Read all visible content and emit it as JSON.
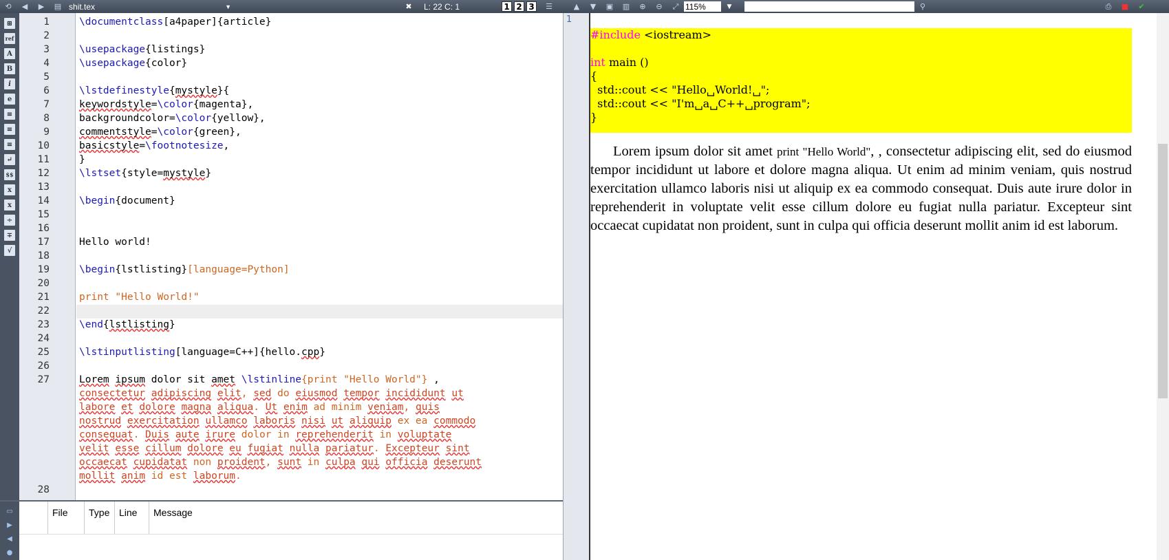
{
  "toolbar": {
    "file_name": "shit.tex",
    "position": "L: 22 C: 1",
    "view_buttons": [
      "1",
      "2",
      "3"
    ],
    "zoom": "115%",
    "search_value": ""
  },
  "editor": {
    "line_numbers": [
      "1",
      "2",
      "3",
      "4",
      "5",
      "6",
      "7",
      "8",
      "9",
      "10",
      "11",
      "12",
      "13",
      "14",
      "15",
      "16",
      "17",
      "18",
      "19",
      "20",
      "21",
      "22",
      "23",
      "24",
      "25",
      "26",
      "27",
      "28"
    ]
  },
  "log": {
    "columns": [
      "File",
      "Type",
      "Line",
      "Message"
    ]
  },
  "viewer": {
    "page_number": "1",
    "listing_lines": [
      "#include <iostream>",
      "",
      "int main ()",
      "{",
      "  std::cout << \"Hello␣World!␣\";",
      "  std::cout << \"I'm␣a␣C++␣program\";",
      "}"
    ],
    "paragraph_before": "Lorem ipsum dolor sit amet ",
    "paragraph_inline": "print \"Hello World\"",
    "paragraph_after": ", , consectetur adipiscing elit, sed do eiusmod tempor incididunt ut labore et dolore magna aliqua. Ut enim ad minim veniam, quis nostrud exercitation ullamco laboris nisi ut aliquip ex ea commodo consequat. Duis aute irure dolor in reprehenderit in voluptate velit esse cillum dolore eu fugiat nulla pariatur. Excepteur sint occaecat cupidatat non proident, sunt in culpa qui officia deserunt mollit anim id est laborum."
  },
  "colors": {
    "listing_background": "#ffff00",
    "keyword": "#ff00ff",
    "latex_command": "#1d1ab4",
    "option": "#cc6622"
  }
}
